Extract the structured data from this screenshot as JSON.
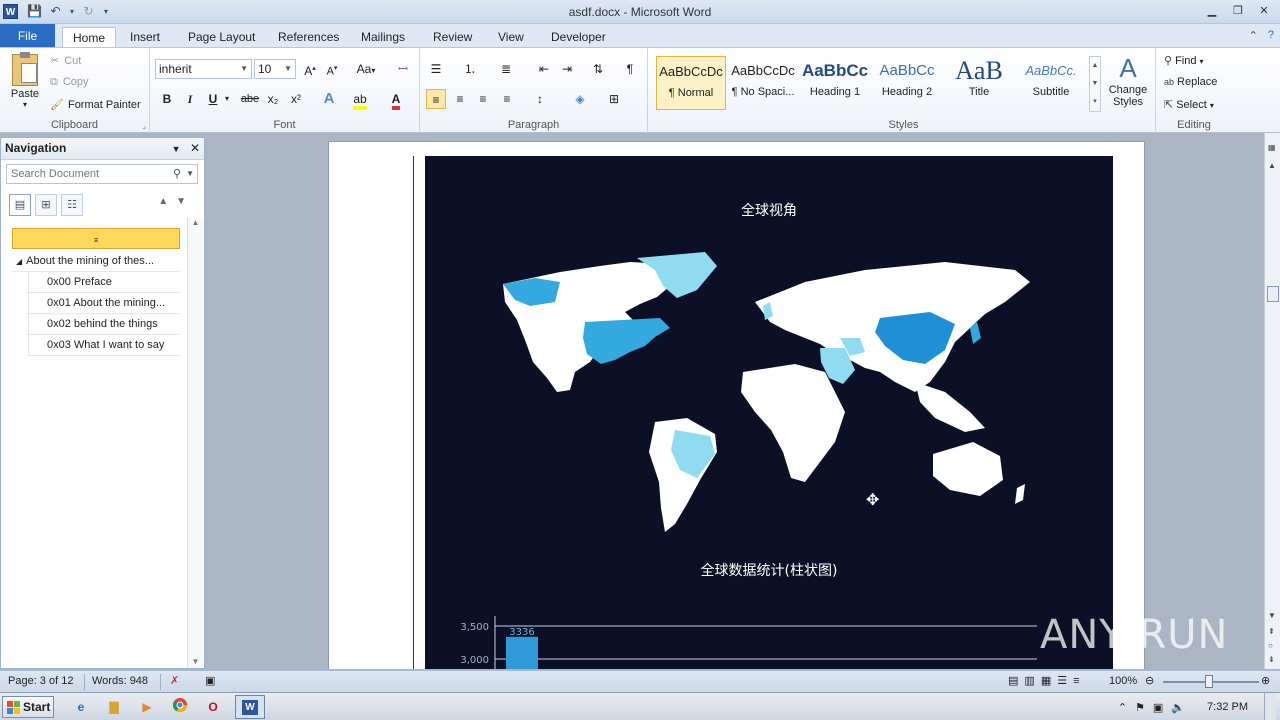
{
  "window": {
    "title": "asdf.docx - Microsoft Word",
    "app_logo": "W"
  },
  "ribbon": {
    "tabs": [
      "File",
      "Home",
      "Insert",
      "Page Layout",
      "References",
      "Mailings",
      "Review",
      "View",
      "Developer"
    ],
    "active_tab": "Home",
    "clipboard": {
      "paste": "Paste",
      "cut": "Cut",
      "copy": "Copy",
      "format_painter": "Format Painter",
      "label": "Clipboard"
    },
    "font": {
      "font_name": "inherit",
      "font_size": "10",
      "label": "Font",
      "bold": "B",
      "italic": "I",
      "underline": "U",
      "strike": "abe",
      "subscript": "x₂",
      "superscript": "x²",
      "change_case": "Aa"
    },
    "paragraph": {
      "label": "Paragraph"
    },
    "styles": {
      "label": "Styles",
      "items": [
        {
          "sample": "AaBbCcDc",
          "name": "¶ Normal"
        },
        {
          "sample": "AaBbCcDc",
          "name": "¶ No Spaci..."
        },
        {
          "sample": "AaBbCc",
          "name": "Heading 1"
        },
        {
          "sample": "AaBbCc",
          "name": "Heading 2"
        },
        {
          "sample": "AaB",
          "name": "Title"
        },
        {
          "sample": "AaBbCc.",
          "name": "Subtitle"
        }
      ],
      "change_styles": "Change Styles"
    },
    "editing": {
      "label": "Editing",
      "find": "Find",
      "replace": "Replace",
      "select": "Select"
    }
  },
  "navigation": {
    "title": "Navigation",
    "search_placeholder": "Search Document",
    "items": [
      {
        "level": 1,
        "text": "About the mining of thes..."
      },
      {
        "level": 2,
        "text": "0x00 Preface"
      },
      {
        "level": 2,
        "text": "0x01 About the mining..."
      },
      {
        "level": 2,
        "text": "0x02 behind the things"
      },
      {
        "level": 2,
        "text": "0x03 What I want to say"
      }
    ]
  },
  "document": {
    "map_title": "全球视角",
    "bar_title": "全球数据统计(柱状图)",
    "ticks": [
      "3,500",
      "3,000"
    ],
    "bar_label": "3336",
    "colors": {
      "background": "#0b1027",
      "land": "#ffffff",
      "high": "#1f8fd6",
      "mid": "#33a9e0",
      "low": "#8fdcf0"
    }
  },
  "chart_data": {
    "type": "bar",
    "title": "全球数据统计(柱状图)",
    "categories": [
      ""
    ],
    "values": [
      3336
    ],
    "ylim": [
      0,
      3500
    ],
    "yticks": [
      3000,
      3500
    ]
  },
  "status": {
    "page": "Page: 3 of 12",
    "words": "Words: 948",
    "zoom": "100%"
  },
  "taskbar": {
    "start": "Start",
    "clock": "7:32 PM"
  },
  "watermark": "ANY RUN"
}
